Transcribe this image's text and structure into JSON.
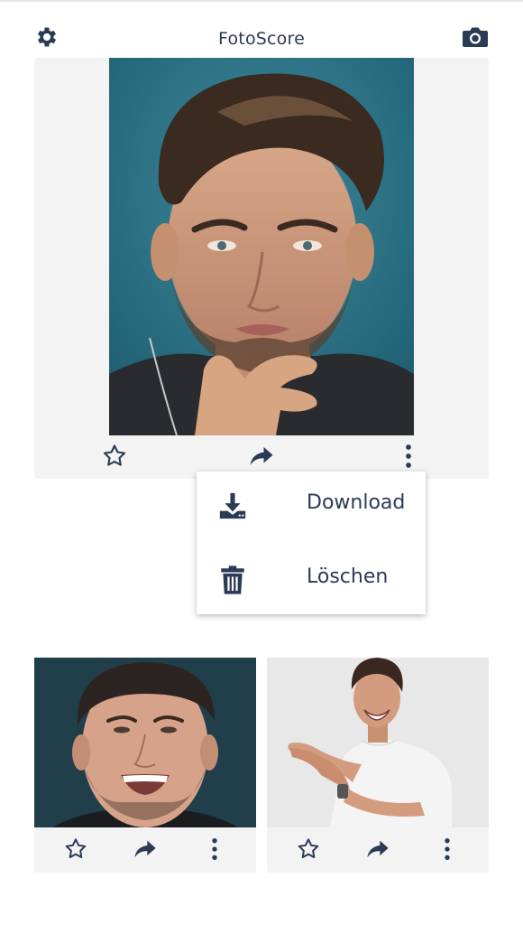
{
  "app": {
    "title": "FotoScore"
  },
  "header": {
    "left_icon": "gear-icon",
    "right_icon": "camera-icon"
  },
  "colors": {
    "icon": "#2b3a55",
    "card_bg": "#f3f3f3",
    "menu_bg": "#ffffff"
  },
  "main_card": {
    "photo": "portrait of a man with hand on chin against teal background",
    "actions": [
      "star-outline-icon",
      "share-arrow-icon",
      "more-vertical-icon"
    ]
  },
  "context_menu": {
    "items": [
      {
        "label": "Download",
        "icon": "download-icon"
      },
      {
        "label": "Löschen",
        "icon": "trash-icon"
      }
    ]
  },
  "grid_cards": [
    {
      "photo": "smiling man on dark teal background",
      "actions": [
        "star-outline-icon",
        "share-arrow-icon",
        "more-vertical-icon"
      ]
    },
    {
      "photo": "smiling man in white t-shirt clapping on light background",
      "actions": [
        "star-outline-icon",
        "share-arrow-icon",
        "more-vertical-icon"
      ]
    }
  ]
}
